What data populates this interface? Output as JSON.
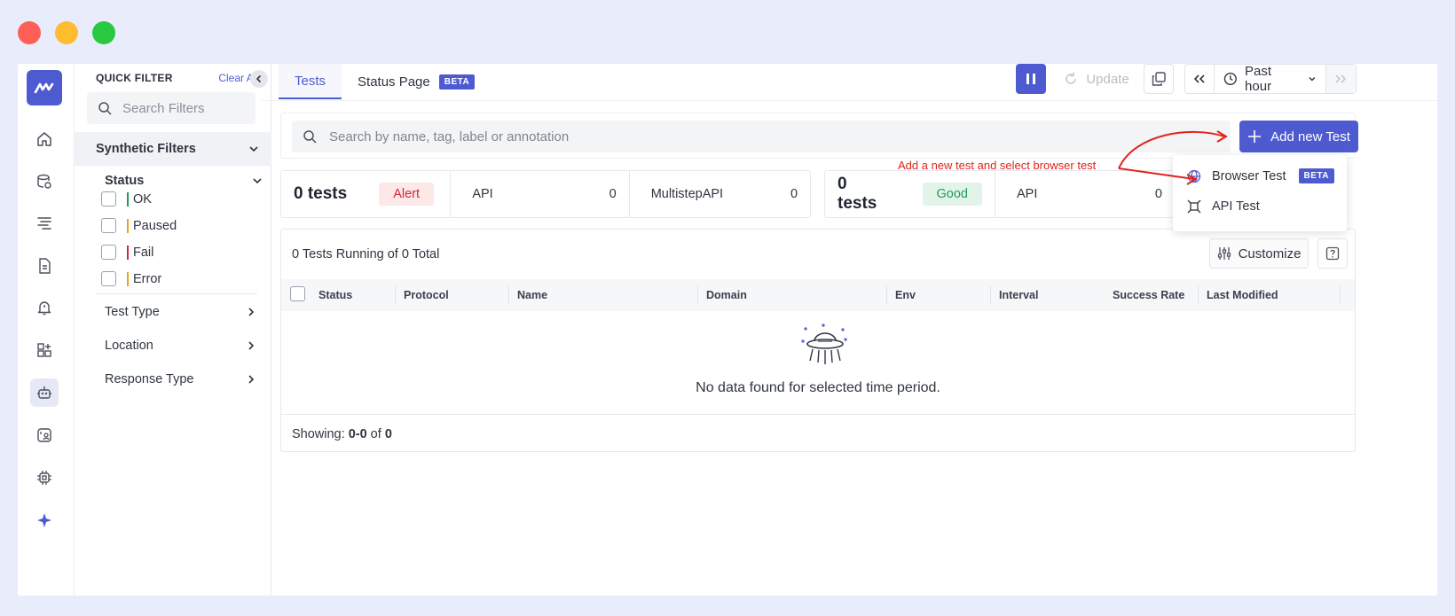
{
  "window_controls": [
    "close",
    "minimize",
    "maximize"
  ],
  "colors": {
    "accent": "#4e5bd0",
    "close": "#fe5f57",
    "minimize": "#febc2e",
    "maximize": "#28c840",
    "annotation": "#e2231a"
  },
  "rail": {
    "icons": [
      "home-icon",
      "database-icon",
      "traces-icon",
      "logs-icon",
      "alerts-icon",
      "dashboards-icon",
      "synthetics-robot-icon",
      "rum-icon",
      "infrastructure-icon",
      "ai-sparkle-icon"
    ],
    "active": "synthetics-robot-icon"
  },
  "filter": {
    "title": "QUICK FILTER",
    "clear_all": "Clear All",
    "search_placeholder": "Search Filters",
    "section": "Synthetic Filters",
    "status_title": "Status",
    "status_options": [
      {
        "label": "OK",
        "color": "#1f9d55"
      },
      {
        "label": "Paused",
        "color": "#f0a020"
      },
      {
        "label": "Fail",
        "color": "#d7263d"
      },
      {
        "label": "Error",
        "color": "#f0a020"
      }
    ],
    "groups": [
      "Test Type",
      "Location",
      "Response Type"
    ]
  },
  "tabs": [
    {
      "label": "Tests",
      "active": true
    },
    {
      "label": "Status Page",
      "badge": "BETA"
    }
  ],
  "toolbar": {
    "update": "Update",
    "time_range": "Past hour"
  },
  "search": {
    "placeholder": "Search by name, tag, label or annotation"
  },
  "add_button": "Add new Test",
  "annotation": "Add a new test and select browser test",
  "dropdown": [
    {
      "label": "Browser Test",
      "badge": "BETA",
      "icon": "globe-icon"
    },
    {
      "label": "API Test",
      "icon": "api-icon"
    }
  ],
  "summary_cards": [
    {
      "count": "0 tests",
      "state": "Alert",
      "items": [
        {
          "label": "API",
          "value": "0"
        },
        {
          "label": "MultistepAPI",
          "value": "0"
        }
      ]
    },
    {
      "count": "0 tests",
      "state": "Good",
      "items": [
        {
          "label": "API",
          "value": "0"
        }
      ]
    }
  ],
  "table": {
    "running": "0 Tests Running of 0 Total",
    "customize": "Customize",
    "columns": [
      "Status",
      "Protocol",
      "Name",
      "Domain",
      "Env",
      "Interval",
      "Success Rate",
      "Last Modified"
    ],
    "empty": "No data found for selected time period.",
    "showing_prefix": "Showing: ",
    "showing_range": "0-0",
    "showing_of": " of ",
    "showing_total": "0"
  }
}
